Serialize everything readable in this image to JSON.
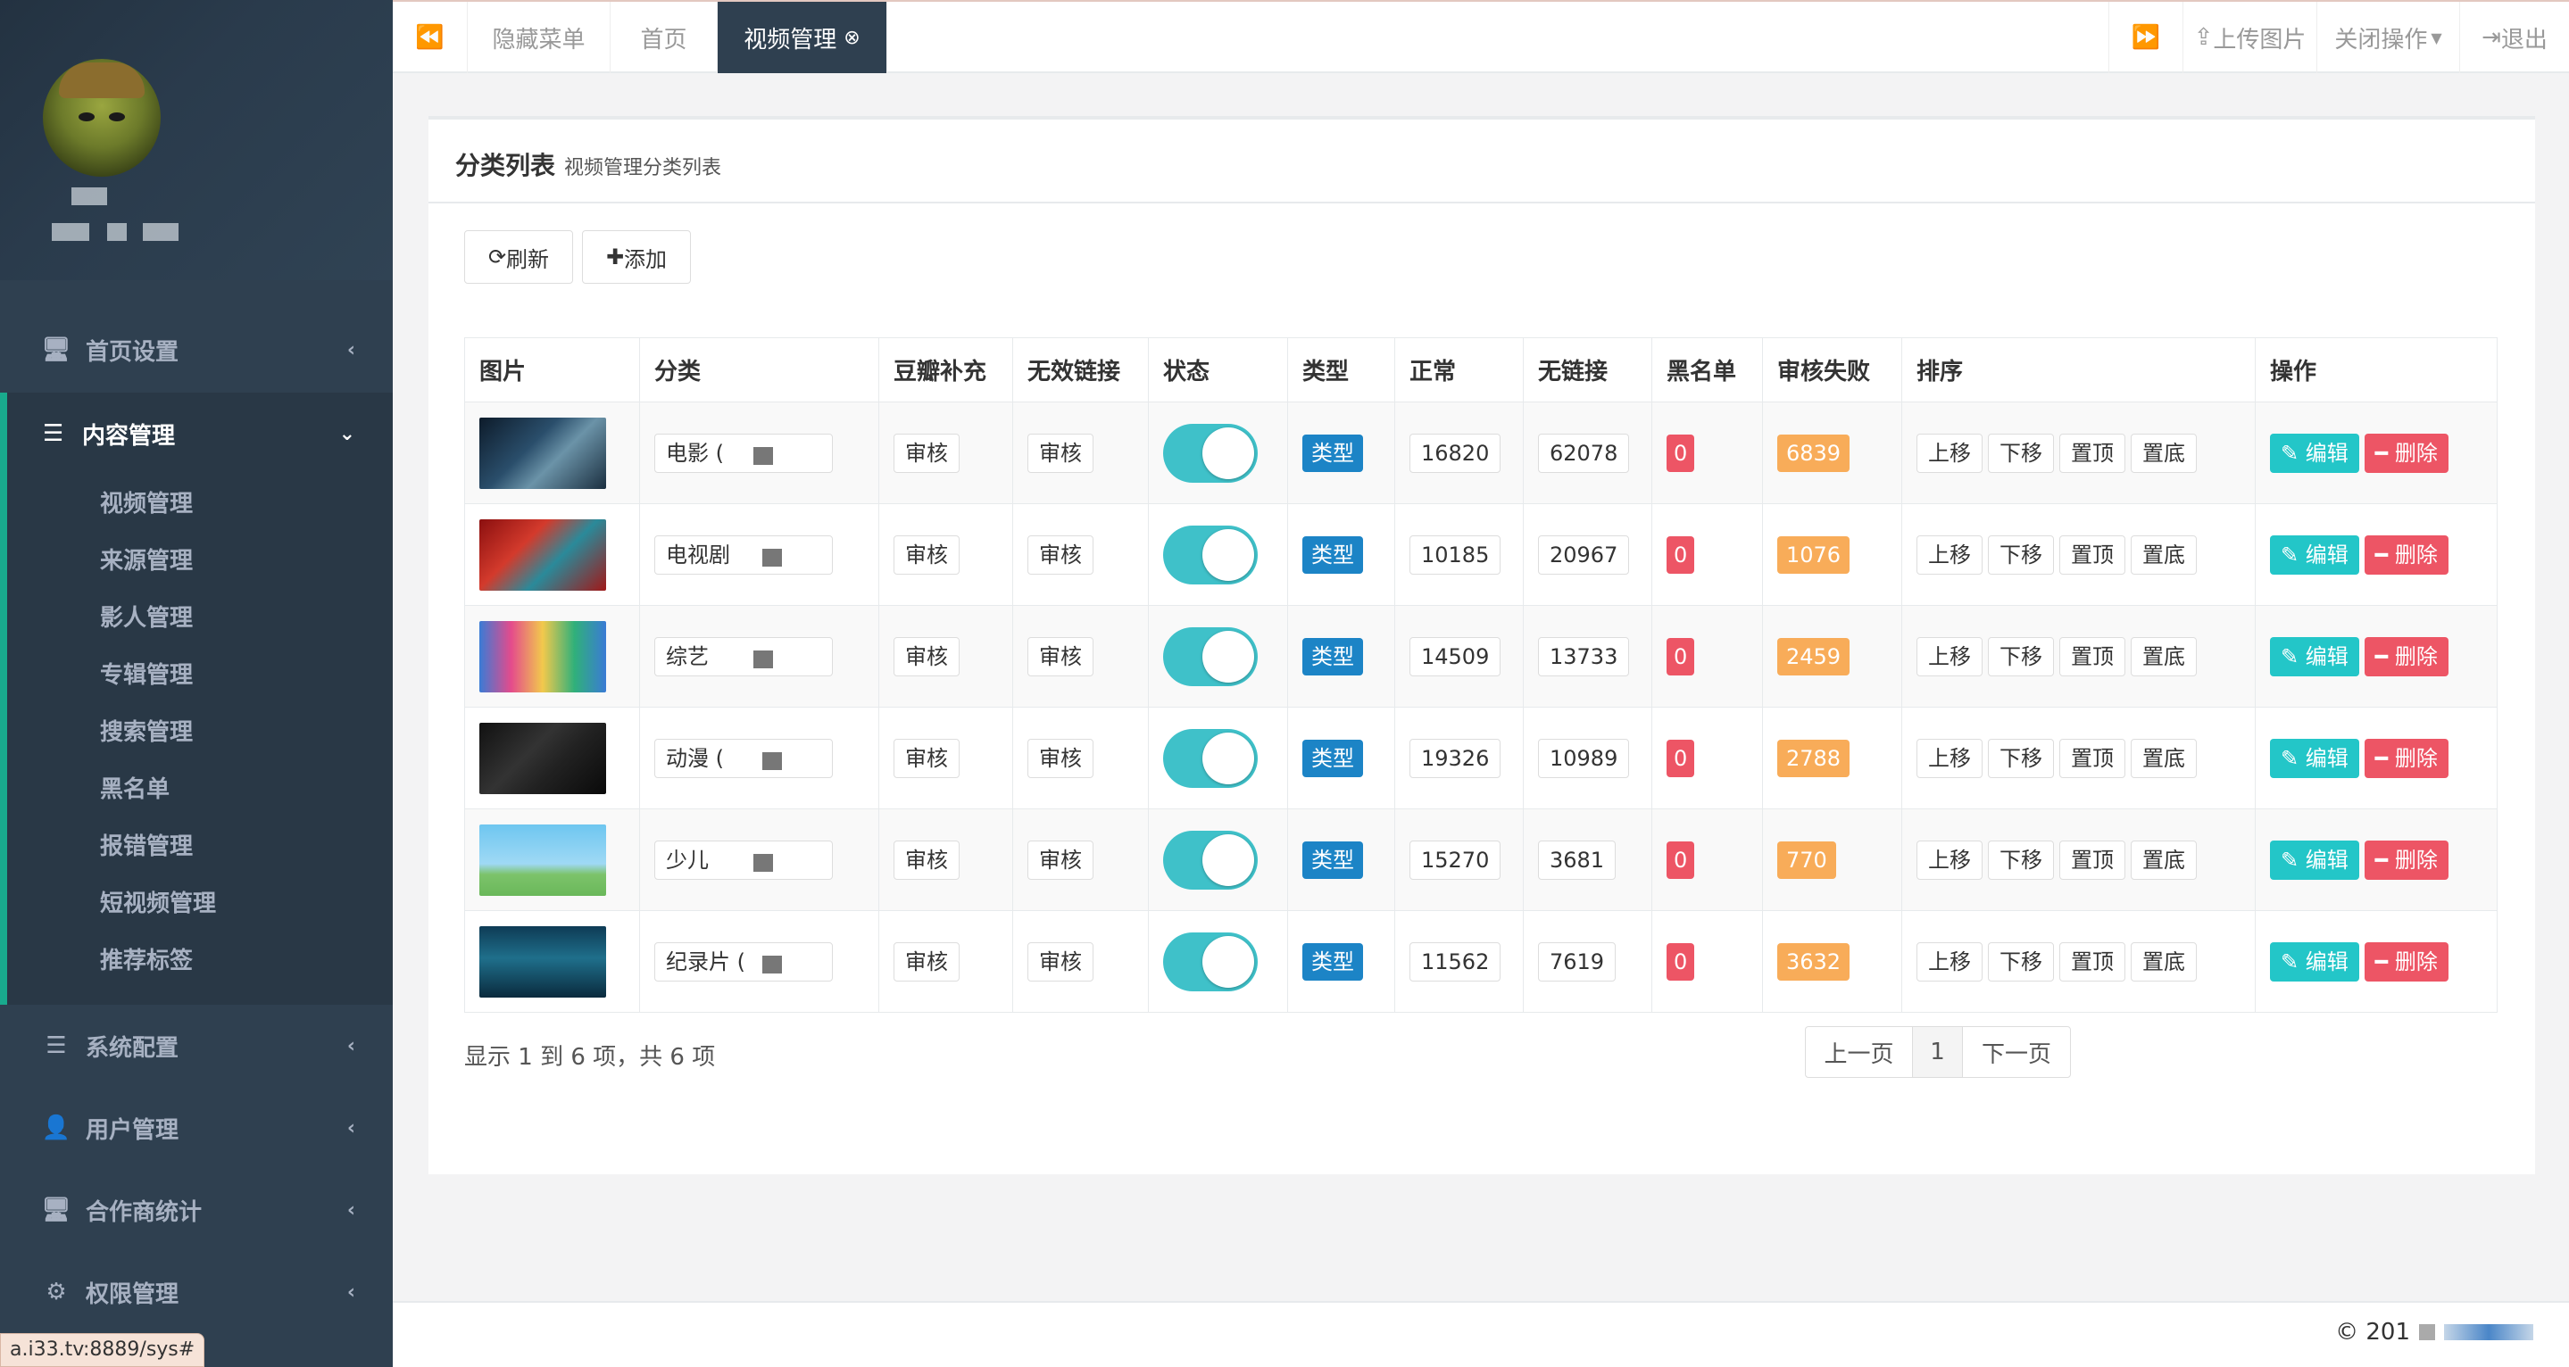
{
  "sidebar": {
    "menu": [
      {
        "label": "首页设置",
        "icon": "monitor-icon"
      },
      {
        "label": "内容管理",
        "icon": "sliders-icon"
      },
      {
        "label": "系统配置",
        "icon": "sliders-icon"
      },
      {
        "label": "用户管理",
        "icon": "user-icon"
      },
      {
        "label": "合作商统计",
        "icon": "monitor-icon"
      },
      {
        "label": "权限管理",
        "icon": "gears-icon"
      }
    ],
    "content_sub": [
      "视频管理",
      "来源管理",
      "影人管理",
      "专辑管理",
      "搜索管理",
      "黑名单",
      "报错管理",
      "短视频管理",
      "推荐标签"
    ]
  },
  "status_url": "a.i33.tv:8889/sys#",
  "topbar": {
    "tabs": [
      "隐藏菜单",
      "首页",
      "视频管理"
    ],
    "upload": "上传图片",
    "close_ops": "关闭操作",
    "logout": "退出"
  },
  "panel": {
    "title": "分类列表",
    "subtitle": "视频管理分类列表",
    "refresh": "刷新",
    "add": "添加"
  },
  "table": {
    "headers": [
      "图片",
      "分类",
      "豆瓣补充",
      "无效链接",
      "状态",
      "类型",
      "正常",
      "无链接",
      "黑名单",
      "审核失败",
      "排序",
      "操作"
    ],
    "audit_label": "审核",
    "type_label": "类型",
    "sort_buttons": [
      "上移",
      "下移",
      "置顶",
      "置底"
    ],
    "edit_label": "编辑",
    "delete_label": "删除",
    "rows": [
      {
        "category": "电影 (",
        "normal": "16820",
        "nolink": "62078",
        "blacklist": "0",
        "fail": "6839",
        "thumb": "thumb-avatar-icon"
      },
      {
        "category": "电视剧",
        "normal": "10185",
        "nolink": "20967",
        "blacklist": "0",
        "fail": "1076",
        "thumb": "thumb-drama-icon"
      },
      {
        "category": "综艺",
        "normal": "14509",
        "nolink": "13733",
        "blacklist": "0",
        "fail": "2459",
        "thumb": "thumb-variety-icon"
      },
      {
        "category": "动漫 (",
        "normal": "19326",
        "nolink": "10989",
        "blacklist": "0",
        "fail": "2788",
        "thumb": "thumb-anime-icon"
      },
      {
        "category": "少儿",
        "normal": "15270",
        "nolink": "3681",
        "blacklist": "0",
        "fail": "770",
        "thumb": "thumb-kids-icon"
      },
      {
        "category": "纪录片 (",
        "normal": "11562",
        "nolink": "7619",
        "blacklist": "0",
        "fail": "3632",
        "thumb": "thumb-doc-icon"
      }
    ]
  },
  "footer": {
    "summary": "显示 1 到 6 项，共 6 项",
    "prev": "上一页",
    "page": "1",
    "next": "下一页",
    "copyright": "© 201"
  },
  "colors": {
    "sidebar": "#2f4050",
    "accent": "#19aa8d",
    "edit": "#23c6c8",
    "delete": "#ed5565",
    "type": "#1c84c6",
    "fail": "#f8ac59",
    "toggle": "#3fc1c9"
  }
}
